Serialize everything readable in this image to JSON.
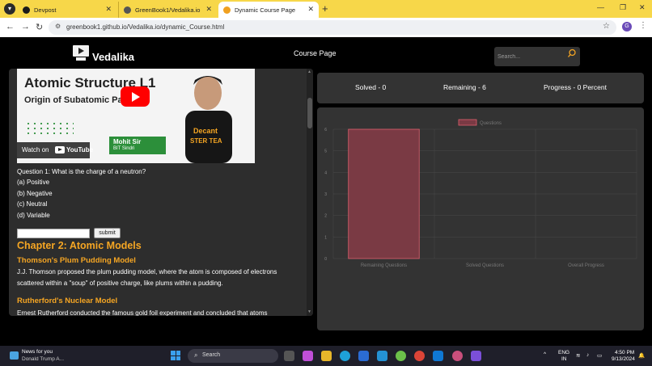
{
  "browser": {
    "tabs": [
      {
        "title": "Devpost",
        "favicon_color": "#1a1a1a"
      },
      {
        "title": "GreenBook1/Vedalika.io",
        "favicon_color": "#555555"
      },
      {
        "title": "Dynamic Course Page",
        "favicon_color": "#f0a020"
      }
    ],
    "url": "greenbook1.github.io/Vedalika.io/dynamic_Course.html",
    "profile_initial": "G"
  },
  "header": {
    "brand": "Vedalika",
    "nav_link": "Course Page",
    "search_placeholder": "Search..."
  },
  "video": {
    "title": "Atomic Structure L1",
    "subtitle": "Origin of Subatomic Particles",
    "presenter": "Mohit Sir",
    "college": "BIT Sindri",
    "shirt_text_1": "Decant",
    "shirt_text_2": "STER TEA",
    "watch_label": "Watch on",
    "youtube_label": "YouTube"
  },
  "quiz": {
    "question": "Question 1: What is the charge of a neutron?",
    "options": [
      "(a) Positive",
      "(b) Negative",
      "(c) Neutral",
      "(d) Variable"
    ],
    "submit_label": "submit"
  },
  "content": {
    "chapter_title": "Chapter 2: Atomic Models",
    "section1_title": "Thomson's Plum Pudding Model",
    "section1_line1": "J.J. Thomson proposed the plum pudding model, where the atom is composed of electrons",
    "section1_line2": "scattered within a \"soup\" of positive charge, like plums within a pudding.",
    "section2_title": "Rutherford's Nuclear Model",
    "section2_line1": "Ernest Rutherford conducted the famous gold foil experiment and concluded that atoms"
  },
  "stats": {
    "solved": "Solved - 0",
    "remaining": "Remaining - 6",
    "progress": "Progress - 0 Percent"
  },
  "chart_data": {
    "type": "bar",
    "categories": [
      "Remaining Questions",
      "Solved Questions",
      "Overall Progress"
    ],
    "series": [
      {
        "name": "Questions",
        "values": [
          6,
          0,
          0
        ]
      }
    ],
    "ylim": [
      0,
      6
    ],
    "yticks": [
      "0",
      "1",
      "2",
      "3",
      "4",
      "5",
      "6"
    ],
    "grid": true,
    "legend": "top",
    "bar_fill": "#7a3a44",
    "bar_stroke": "#e0606e"
  },
  "taskbar": {
    "news_title": "News for you",
    "news_sub": "Donald Trump A...",
    "search_label": "Search",
    "lang_1": "ENG",
    "lang_2": "IN",
    "time": "4:50 PM",
    "date": "9/13/2024"
  }
}
